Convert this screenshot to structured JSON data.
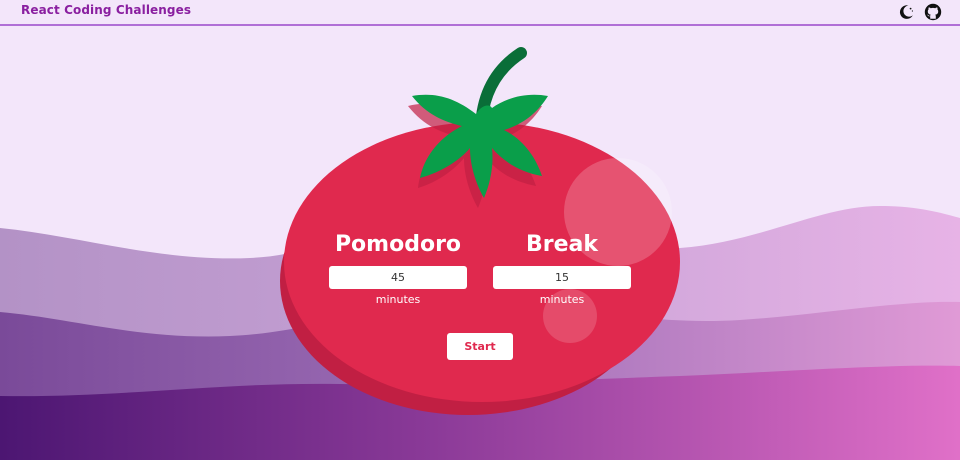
{
  "header": {
    "brand": "React Coding Challenges",
    "icons": [
      "theme-toggle-icon",
      "github-icon"
    ]
  },
  "colors": {
    "tomato": "#e0294e",
    "tomato_shadow": "#c11f43",
    "leaf": "#0a9e4a",
    "stem": "#0a6e38",
    "brand": "#8a1fa0"
  },
  "pomodoro": {
    "label": "Pomodoro",
    "value": "45",
    "unit": "minutes"
  },
  "break": {
    "label": "Break",
    "value": "15",
    "unit": "minutes"
  },
  "start_label": "Start"
}
